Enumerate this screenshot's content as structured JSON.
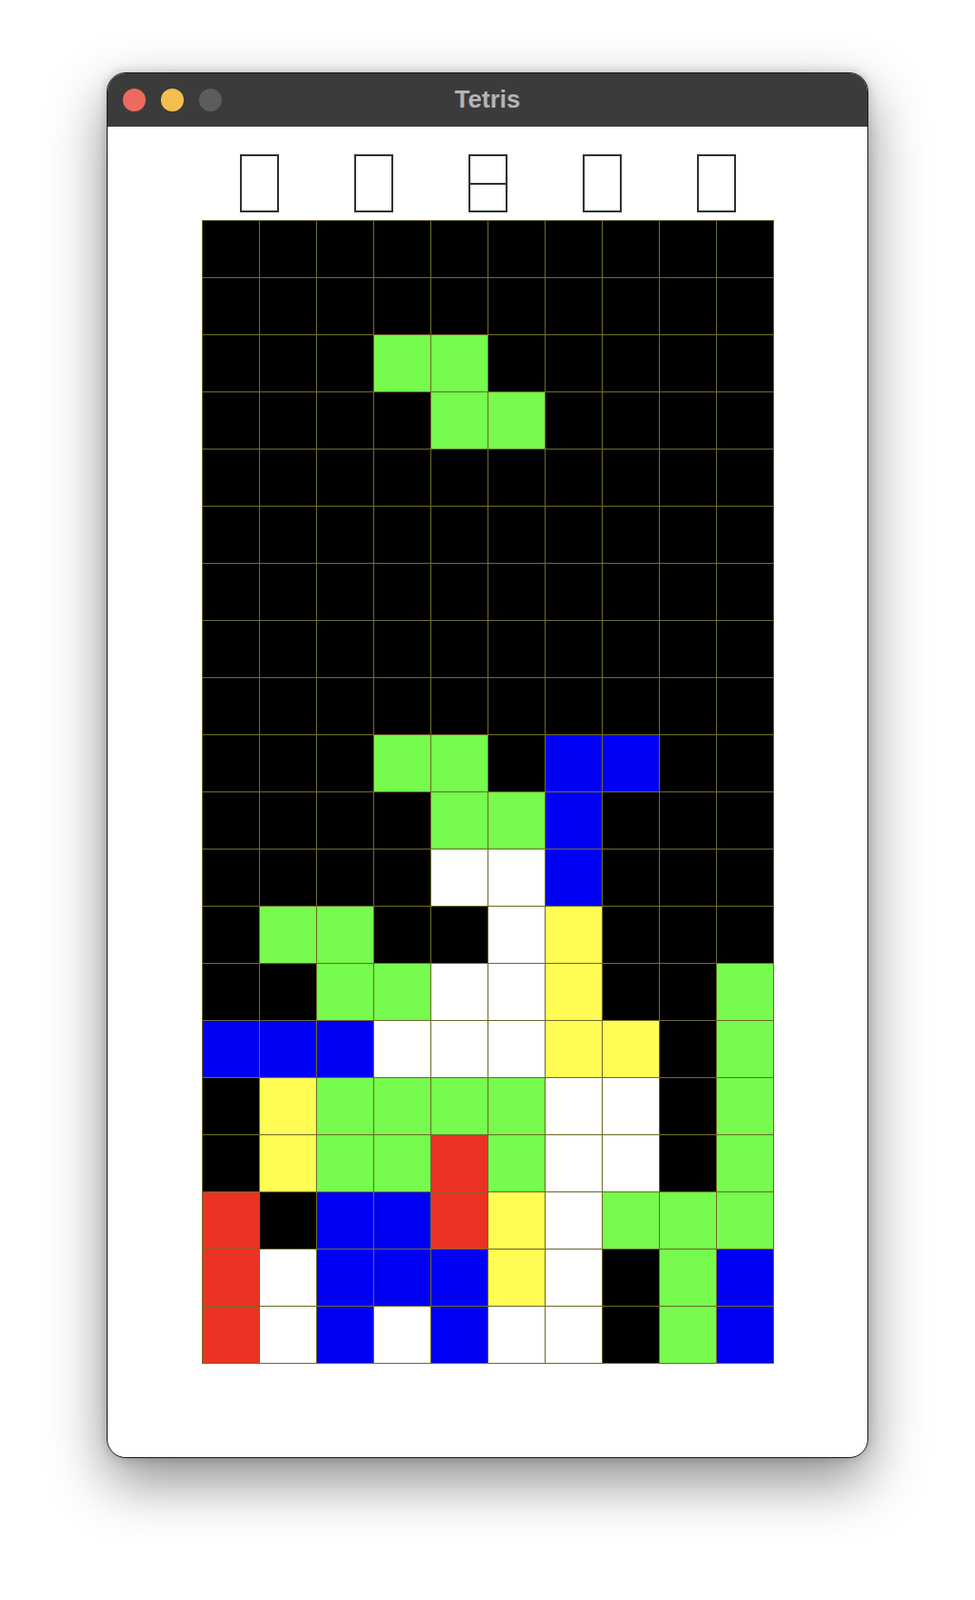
{
  "window": {
    "title": "Tetris"
  },
  "indicators": [
    {
      "split": false
    },
    {
      "split": false
    },
    {
      "split": true
    },
    {
      "split": false
    },
    {
      "split": false
    }
  ],
  "board": {
    "rows": [
      [
        "#000000",
        "#000000",
        "#000000",
        "#000000",
        "#000000",
        "#000000",
        "#000000",
        "#000000",
        "#000000",
        "#000000"
      ],
      [
        "#000000",
        "#000000",
        "#000000",
        "#000000",
        "#000000",
        "#000000",
        "#000000",
        "#000000",
        "#000000",
        "#000000"
      ],
      [
        "#000000",
        "#000000",
        "#000000",
        "#76fb4e",
        "#76fb4e",
        "#000000",
        "#000000",
        "#000000",
        "#000000",
        "#000000"
      ],
      [
        "#000000",
        "#000000",
        "#000000",
        "#000000",
        "#76fb4e",
        "#76fb4e",
        "#000000",
        "#000000",
        "#000000",
        "#000000"
      ],
      [
        "#000000",
        "#000000",
        "#000000",
        "#000000",
        "#000000",
        "#000000",
        "#000000",
        "#000000",
        "#000000",
        "#000000"
      ],
      [
        "#000000",
        "#000000",
        "#000000",
        "#000000",
        "#000000",
        "#000000",
        "#000000",
        "#000000",
        "#000000",
        "#000000"
      ],
      [
        "#000000",
        "#000000",
        "#000000",
        "#000000",
        "#000000",
        "#000000",
        "#000000",
        "#000000",
        "#000000",
        "#000000"
      ],
      [
        "#000000",
        "#000000",
        "#000000",
        "#000000",
        "#000000",
        "#000000",
        "#000000",
        "#000000",
        "#000000",
        "#000000"
      ],
      [
        "#000000",
        "#000000",
        "#000000",
        "#000000",
        "#000000",
        "#000000",
        "#000000",
        "#000000",
        "#000000",
        "#000000"
      ],
      [
        "#000000",
        "#000000",
        "#000000",
        "#76fb4e",
        "#76fb4e",
        "#000000",
        "#0000f5",
        "#0000f5",
        "#000000",
        "#000000"
      ],
      [
        "#000000",
        "#000000",
        "#000000",
        "#000000",
        "#76fb4e",
        "#76fb4e",
        "#0000f5",
        "#000000",
        "#000000",
        "#000000"
      ],
      [
        "#000000",
        "#000000",
        "#000000",
        "#000000",
        "#ffffff",
        "#ffffff",
        "#0000f5",
        "#000000",
        "#000000",
        "#000000"
      ],
      [
        "#000000",
        "#76fb4e",
        "#76fb4e",
        "#000000",
        "#000000",
        "#ffffff",
        "#fffd54",
        "#000000",
        "#000000",
        "#000000"
      ],
      [
        "#000000",
        "#000000",
        "#76fb4e",
        "#76fb4e",
        "#ffffff",
        "#ffffff",
        "#fffd54",
        "#000000",
        "#000000",
        "#76fb4e"
      ],
      [
        "#0000f5",
        "#0000f5",
        "#0000f5",
        "#ffffff",
        "#ffffff",
        "#ffffff",
        "#fffd54",
        "#fffd54",
        "#000000",
        "#76fb4e"
      ],
      [
        "#000000",
        "#fffd54",
        "#76fb4e",
        "#76fb4e",
        "#76fb4e",
        "#76fb4e",
        "#ffffff",
        "#ffffff",
        "#000000",
        "#76fb4e"
      ],
      [
        "#000000",
        "#fffd54",
        "#76fb4e",
        "#76fb4e",
        "#ea3323",
        "#76fb4e",
        "#ffffff",
        "#ffffff",
        "#000000",
        "#76fb4e"
      ],
      [
        "#ea3323",
        "#000000",
        "#0000f5",
        "#0000f5",
        "#ea3323",
        "#fffd54",
        "#ffffff",
        "#76fb4e",
        "#76fb4e",
        "#76fb4e"
      ],
      [
        "#ea3323",
        "#ffffff",
        "#0000f5",
        "#0000f5",
        "#0000f5",
        "#fffd54",
        "#ffffff",
        "#000000",
        "#76fb4e",
        "#0000f5"
      ],
      [
        "#ea3323",
        "#ffffff",
        "#0000f5",
        "#ffffff",
        "#0000f5",
        "#ffffff",
        "#ffffff",
        "#000000",
        "#76fb4e",
        "#0000f5"
      ]
    ]
  }
}
